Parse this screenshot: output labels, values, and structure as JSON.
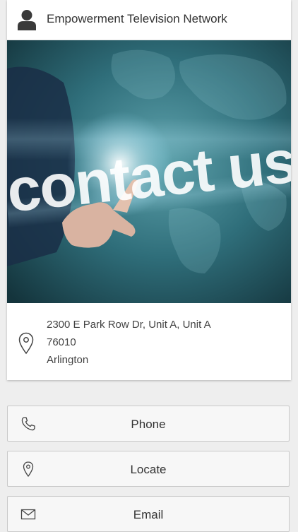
{
  "header": {
    "title": "Empowerment Television Network"
  },
  "hero": {
    "headline": "contact us"
  },
  "address": {
    "line1": "2300 E Park Row Dr, Unit A, Unit A",
    "line2": "76010",
    "line3": "Arlington"
  },
  "actions": [
    {
      "label": "Phone",
      "icon": "phone-icon"
    },
    {
      "label": "Locate",
      "icon": "location-pin-icon"
    },
    {
      "label": "Email",
      "icon": "envelope-icon"
    }
  ],
  "colors": {
    "background": "#eeeeee",
    "card": "#ffffff",
    "button_bg": "#f7f7f7",
    "button_border": "#c9c9c9",
    "hero_teal": "#2f6e7a",
    "text": "#333333"
  }
}
